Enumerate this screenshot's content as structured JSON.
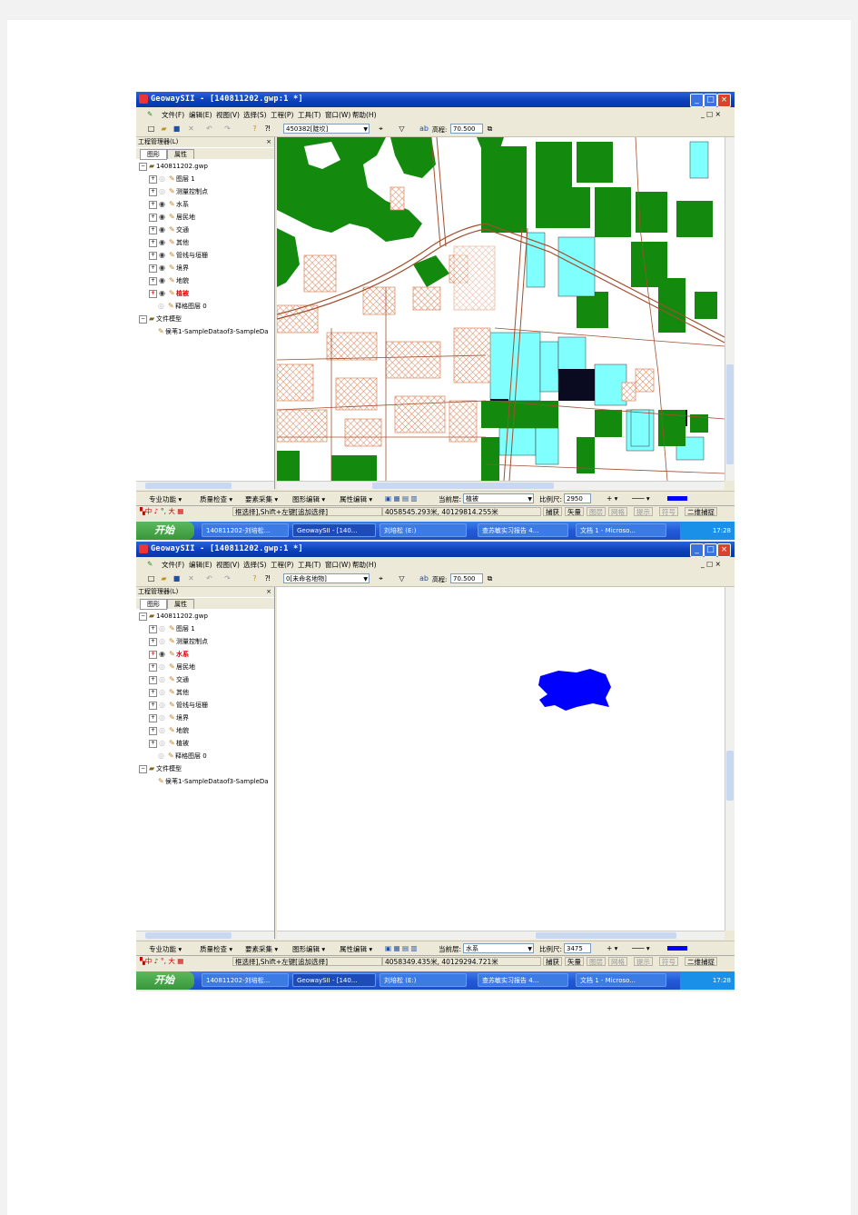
{
  "window": {
    "title": "GeowaySII - [140811202.gwp:1 *]",
    "menus": [
      "文件(F)",
      "编辑(E)",
      "视图(V)",
      "选择(S)",
      "工程(P)",
      "工具(T)",
      "窗口(W)",
      "帮助(H)"
    ],
    "min_label": "_",
    "max_label": "□",
    "close_label": "×"
  },
  "shot1": {
    "layer_combo": "450382[陡坎]",
    "elevation_label": "高程:",
    "elevation_value": "70.500",
    "current_layer_label": "当前层:",
    "current_layer": "植被",
    "scale_label": "比例尺:",
    "scale_value": "2950",
    "status_hint": "框选择],Shift+左键[追加选择]",
    "coords": "4058545.293米, 40129814.255米",
    "highlighted_layer": "植被"
  },
  "shot2": {
    "layer_combo": "0[未命名地物]",
    "elevation_label": "高程:",
    "elevation_value": "70.500",
    "current_layer_label": "当前层:",
    "current_layer": "水系",
    "scale_label": "比例尺:",
    "scale_value": "3475",
    "status_hint": "框选择],Shift+左键[追加选择]",
    "coords": "4058349.435米, 40129294.721米",
    "highlighted_layer": "水系"
  },
  "panel": {
    "title": "工程管理器(L)",
    "close": "×",
    "tab_graphics": "图形",
    "tab_attributes": "属性",
    "project_file": "140811202.gwp",
    "layers": [
      "图层 1",
      "测量控制点",
      "水系",
      "居民地",
      "交通",
      "其他",
      "管线与垣栅",
      "境界",
      "地貌",
      "植被",
      "释格图层 0"
    ],
    "file_model": "文件模型",
    "file_model_child": "侯苇1-SampleDataof3-SampleDa"
  },
  "toolbar2": {
    "buttons": [
      "专业功能",
      "质量检查",
      "要素采集",
      "图形编辑",
      "属性编辑"
    ],
    "dropdown_arrow": "▾"
  },
  "status": {
    "ime": "中",
    "ime_symbols": "♪ °, 大",
    "fields": [
      "捕获",
      "矢量",
      "图层",
      "网格",
      "提示",
      "符号",
      "二维捕捉"
    ]
  },
  "taskbar": {
    "start": "开始",
    "tasks": [
      "140811202-刘培松...",
      "GeowaySII - [140...",
      "刘培松 (E:)",
      "查苏敏实习报告 4...",
      "文档 1 - Microso..."
    ],
    "clock": "17:28"
  },
  "colors": {
    "vegetation": "#138a0d",
    "water_light": "#80ffff",
    "residential": "#d9835a",
    "road": "#a05030",
    "blue_polygon": "#0000ff",
    "dark_building": "#0a0a20"
  }
}
